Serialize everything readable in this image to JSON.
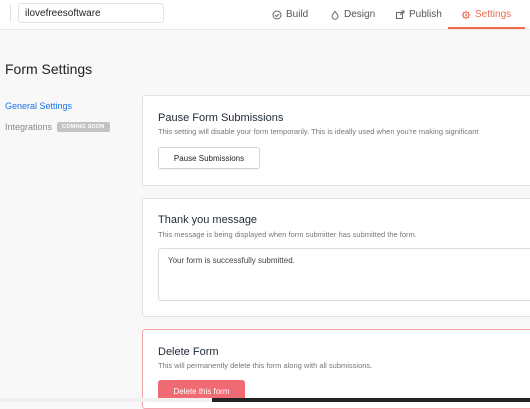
{
  "header": {
    "form_name": "ilovefreesoftware",
    "tabs": [
      {
        "label": "Build",
        "icon": "check-circle-icon",
        "active": false
      },
      {
        "label": "Design",
        "icon": "paint-drop-icon",
        "active": false
      },
      {
        "label": "Publish",
        "icon": "external-link-icon",
        "active": false
      },
      {
        "label": "Settings",
        "icon": "gear-icon",
        "active": true
      }
    ]
  },
  "page": {
    "title": "Form Settings"
  },
  "sidebar": {
    "items": [
      {
        "label": "General Settings",
        "active": true
      },
      {
        "label": "Integrations",
        "badge": "COMING SOON"
      }
    ]
  },
  "pause": {
    "title": "Pause Form Submissions",
    "description": "This setting will disable your form temporarily. This is ideally used when you're making significant",
    "button": "Pause Submissions"
  },
  "thanks": {
    "title": "Thank you message",
    "description": "This message is being displayed when form submitter has submitted the form.",
    "message": "Your form is successfully submitted."
  },
  "delete": {
    "title": "Delete Form",
    "description": "This will permanently delete this form along with all submissions.",
    "button": "Delete this form"
  },
  "colors": {
    "accent": "#f06a50",
    "link": "#1a73e8",
    "danger": "#f06a73"
  }
}
